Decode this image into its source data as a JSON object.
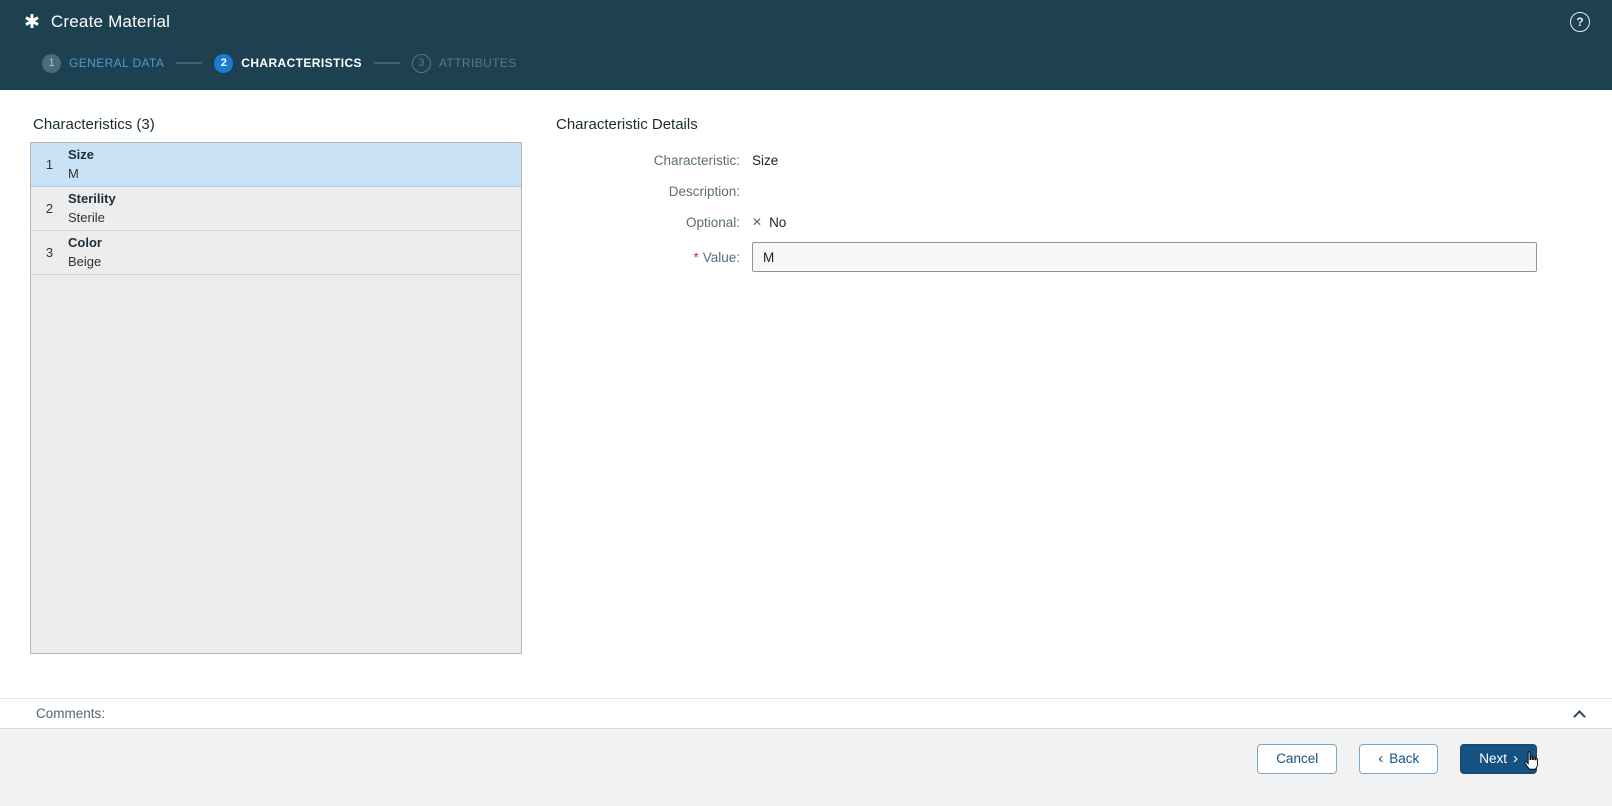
{
  "header": {
    "title": "Create Material",
    "app_icon_glyph": "✱",
    "help_glyph": "?"
  },
  "wizard": {
    "steps": [
      {
        "number": "1",
        "label": "GENERAL DATA",
        "state": "completed"
      },
      {
        "number": "2",
        "label": "CHARACTERISTICS",
        "state": "active"
      },
      {
        "number": "3",
        "label": "ATTRIBUTES",
        "state": "upcoming"
      }
    ]
  },
  "left_panel": {
    "title": "Characteristics (3)",
    "items": [
      {
        "index": "1",
        "name": "Size",
        "value": "M",
        "selected": true
      },
      {
        "index": "2",
        "name": "Sterility",
        "value": "Sterile",
        "selected": false
      },
      {
        "index": "3",
        "name": "Color",
        "value": "Beige",
        "selected": false
      }
    ]
  },
  "details": {
    "title": "Characteristic Details",
    "characteristic_label": "Characteristic:",
    "characteristic_value": "Size",
    "description_label": "Description:",
    "description_value": "",
    "optional_label": "Optional:",
    "optional_icon": "✕",
    "optional_value": "No",
    "value_required_mark": "*",
    "value_label": "Value:",
    "value_input": "M"
  },
  "comments": {
    "label": "Comments:"
  },
  "footer": {
    "cancel_label": "Cancel",
    "back_chevron": "‹",
    "back_label": "Back",
    "next_label": "Next",
    "next_chevron": "›"
  },
  "colors": {
    "header_bg": "#1d4151",
    "accent_blue": "#1c7cd5",
    "selected_row_bg": "#c9e2f6",
    "primary_button_bg": "#155282",
    "required_mark": "#c0392b"
  }
}
